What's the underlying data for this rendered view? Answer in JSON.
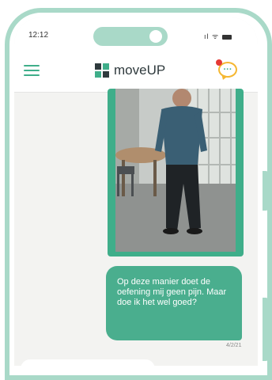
{
  "status_bar": {
    "time": "12:12",
    "signal": "ıl",
    "wifi": "ᯤ"
  },
  "header": {
    "brand": "moveUP"
  },
  "colors": {
    "accent": "#3fae8a",
    "frame": "#a9d9c8",
    "notification": "#f5b731",
    "badge": "#e53935"
  },
  "icons": {
    "menu": "hamburger-icon",
    "logo": "moveup-logo-icon",
    "chat": "chat-bubble-icon"
  },
  "chat": {
    "messages": [
      {
        "type": "video",
        "direction": "outgoing"
      },
      {
        "type": "text",
        "direction": "outgoing",
        "text": "Op deze manier doet de oefening mij geen pijn. Maar doe ik het wel goed?",
        "time": "4/2/21"
      },
      {
        "type": "text",
        "direction": "incoming"
      }
    ]
  },
  "chat_icon_glyph": "···"
}
